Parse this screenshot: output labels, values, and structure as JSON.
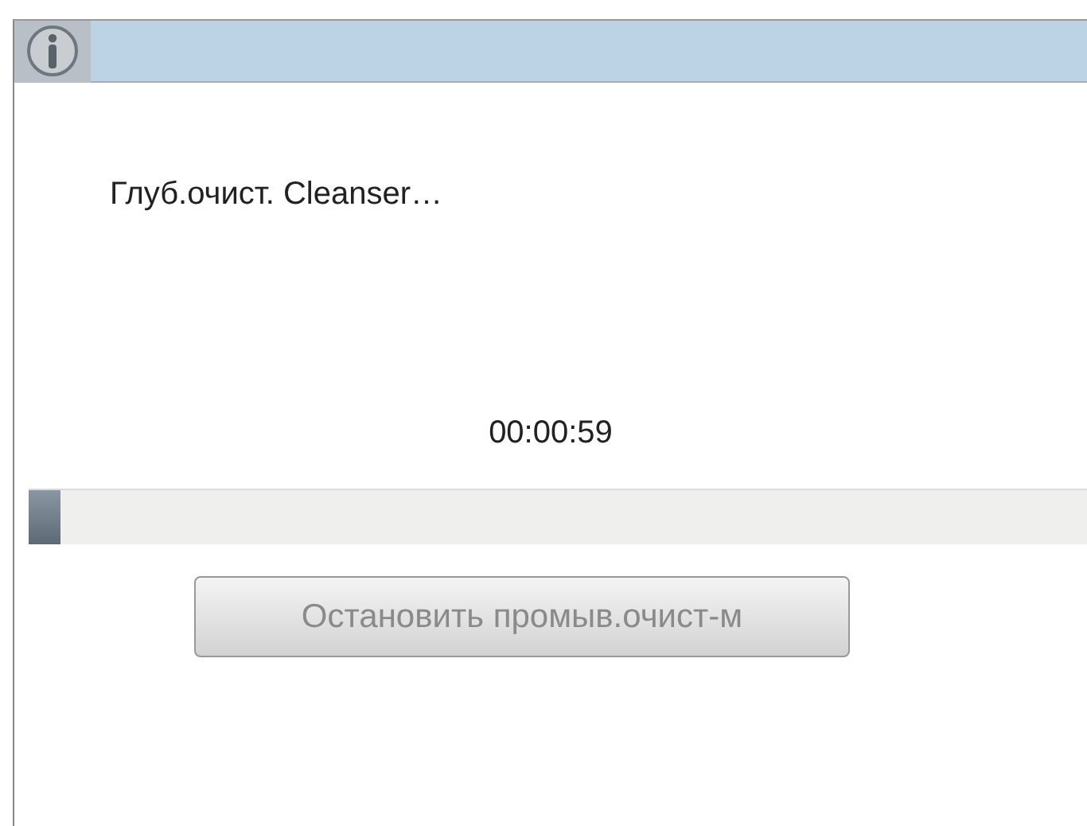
{
  "dialog": {
    "message": "Глуб.очист.  Cleanser…",
    "timer": "00:00:59",
    "progress": {
      "level": 0.03
    },
    "button": {
      "label": "Остановить промыв.очист-м",
      "disabled": true
    }
  }
}
